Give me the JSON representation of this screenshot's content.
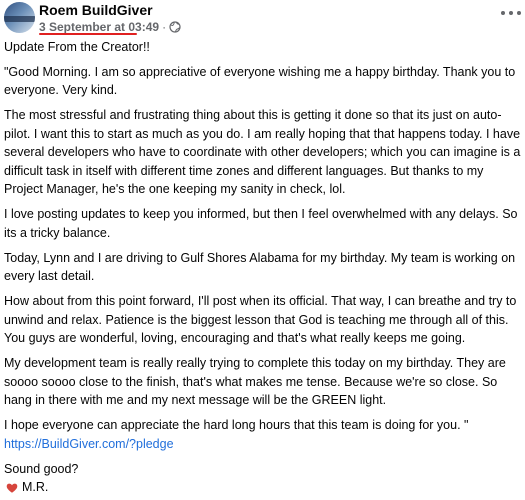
{
  "post": {
    "author": "Roem BuildGiver",
    "date": "3 September at 03:49",
    "separator": "·",
    "privacy_icon": "globe-icon",
    "menu_icon": "more-options-icon",
    "title": "Update From the Creator!!",
    "paragraphs": [
      "\"Good Morning.  I am so appreciative of everyone wishing me a happy birthday.  Thank you to everyone.  Very kind.",
      "The most stressful and frustrating thing about this is getting it done so that its just on auto-pilot.  I want this to start as much as you do. I am really hoping that that happens today. I have several developers who have to coordinate with other developers; which you can imagine is a difficult task in itself with different time zones and different languages.  But thanks to my Project Manager, he's the one keeping my sanity in check,  lol.",
      "I love posting updates to keep you informed,  but then I feel overwhelmed with any delays. So its a tricky balance.",
      "Today, Lynn and I are driving to Gulf Shores Alabama for my birthday.  My team is working on every last detail.",
      "How about  from this point forward,  I'll post when its official.  That way, I can breathe and try to unwind and relax.  Patience is the biggest lesson that God is teaching me through all of this. You guys are wonderful,  loving,  encouraging and that's what really keeps me going.",
      "My development team is really really trying to complete this today on my birthday.  They are soooo soooo close to the finish,  that's what makes me tense. Because we're so close.  So hang in there with me and my next message will be the GREEN light.",
      "I hope everyone can appreciate the hard long hours that this team is doing for you. \""
    ],
    "link": "https://BuildGiver.com/?pledge",
    "closing": "Sound good?",
    "signature_icon": "heart-icon",
    "signature": "M.R."
  },
  "colors": {
    "text": "#050505",
    "meta": "#65676b",
    "link": "#216fdb",
    "highlight": "#e02020",
    "heart": "#d6453c"
  }
}
